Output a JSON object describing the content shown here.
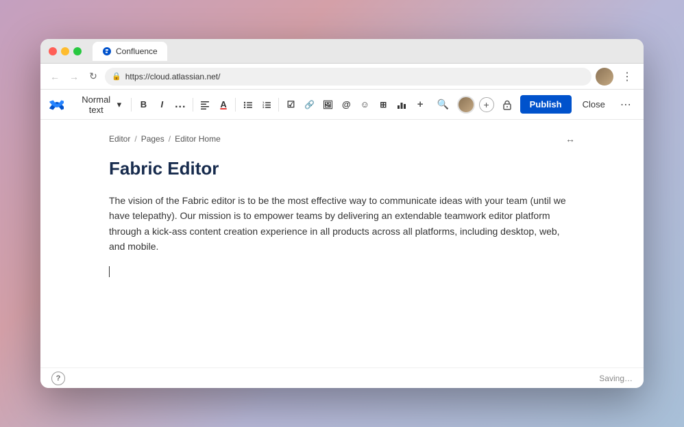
{
  "browser": {
    "tab_title": "Confluence",
    "url": "https://cloud.atlassian.net/",
    "favicon_color": "#0052cc"
  },
  "nav": {
    "back_label": "←",
    "forward_label": "→",
    "refresh_label": "↻",
    "lock_icon": "🔒",
    "address": "https://cloud.atlassian.net/",
    "more_label": "⋮"
  },
  "toolbar": {
    "paragraph_style": "Normal text",
    "chevron_down": "▾",
    "bold_label": "B",
    "italic_label": "I",
    "more_label": "...",
    "align_label": "≡",
    "color_label": "A",
    "bullet_label": "≔",
    "number_label": "⒈",
    "task_label": "☑",
    "link_label": "🔗",
    "image_label": "🖼",
    "mention_label": "@",
    "emoji_label": "☺",
    "table_label": "⊞",
    "chart_label": "▦",
    "insert_more": "+",
    "search_label": "🔍",
    "add_label": "+",
    "restrict_label": "🔒",
    "publish_label": "Publish",
    "close_label": "Close",
    "more_options": "⋯"
  },
  "breadcrumb": {
    "items": [
      "Editor",
      "Pages",
      "Editor Home"
    ],
    "separators": [
      "/",
      "/"
    ]
  },
  "editor": {
    "title": "Fabric Editor",
    "body_text": "The vision of the Fabric editor is to be the most effective way to communicate ideas with your team (until we have telepathy). Our mission is to empower teams by delivering an extendable teamwork editor platform through a kick-ass content creation experience in all products across all platforms, including desktop, web, and mobile."
  },
  "status": {
    "help_label": "?",
    "saving_label": "Saving…"
  }
}
